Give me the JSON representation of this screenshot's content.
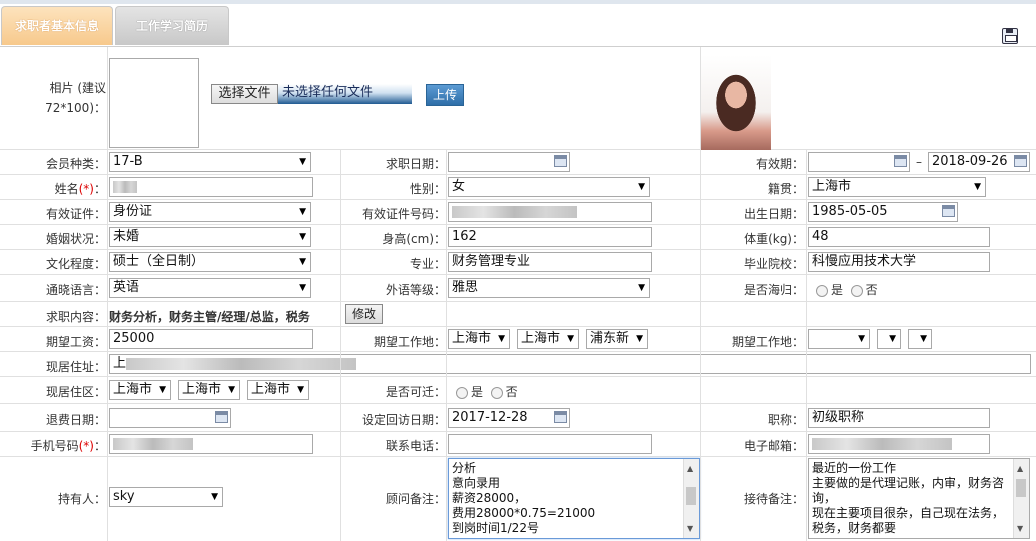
{
  "tabs": [
    {
      "label": "求职者基本信息"
    },
    {
      "label": "工作学习简历"
    }
  ],
  "photo": {
    "label": "相片 (建议 72*100)：",
    "choose_file": "选择文件",
    "no_file": "未选择任何文件",
    "upload": "上传"
  },
  "fields": {
    "member_type_label": "会员种类：",
    "member_type": "17-B",
    "job_date_label": "求职日期：",
    "job_date": "",
    "valid_period_label": "有效期：",
    "valid_start": "",
    "valid_dash": "–",
    "valid_end": "2018-09-26",
    "name_label": "姓名",
    "name_req": "(*)",
    "name_colon": "：",
    "gender_label": "性别：",
    "gender": "女",
    "native_label": "籍贯：",
    "native": "上海市",
    "id_type_label": "有效证件：",
    "id_type": "身份证",
    "id_no_label": "有效证件号码：",
    "birth_label": "出生日期：",
    "birth": "1985-05-05",
    "marital_label": "婚姻状况：",
    "marital": "未婚",
    "height_label": "身高(cm)：",
    "height": "162",
    "weight_label": "体重(kg)：",
    "weight": "48",
    "edu_label": "文化程度：",
    "edu": "硕士（全日制）",
    "major_label": "专业：",
    "major": "财务管理专业",
    "school_label": "毕业院校：",
    "school": "科慢应用技术大学",
    "lang_label": "通晓语言：",
    "lang": "英语",
    "lang_level_label": "外语等级：",
    "lang_level": "雅思",
    "overseas_label": "是否海归：",
    "yes": "是",
    "no": "否",
    "job_content_label": "求职内容：",
    "job_content": "财务分析，财务主管/经理/总监，税务",
    "modify": "修改",
    "salary_label": "期望工资：",
    "salary": "25000",
    "work_place_label": "期望工作地：",
    "wp1": "上海市",
    "wp2": "上海市",
    "wp3": "浦东新",
    "work_place2_label": "期望工作地：",
    "address_label": "现居住址：",
    "address_prefix": "上",
    "district_label": "现居住区：",
    "d1": "上海市",
    "d2": "上海市",
    "d3": "上海市",
    "relocate_label": "是否可迁：",
    "refund_label": "退费日期：",
    "revisit_label": "设定回访日期：",
    "revisit": "2017-12-28",
    "title_label": "职称：",
    "title": "初级职称",
    "mobile_label": "手机号码",
    "mobile_req": "(*)",
    "mobile_colon": "：",
    "phone_label": "联系电话：",
    "email_label": "电子邮箱：",
    "holder_label": "持有人：",
    "holder": "sky",
    "consultant_label": "顾问备注：",
    "consultant_note": "分析\n意向录用\n薪资28000，\n费用28000*0.75=21000\n到岗时间1/22号",
    "reception_label": "接待备注：",
    "reception_note": "最近的一份工作\n主要做的是代理记账，内审，财务咨询，\n现在主要项目很杂，自己现在法务，税务，财务都要"
  }
}
